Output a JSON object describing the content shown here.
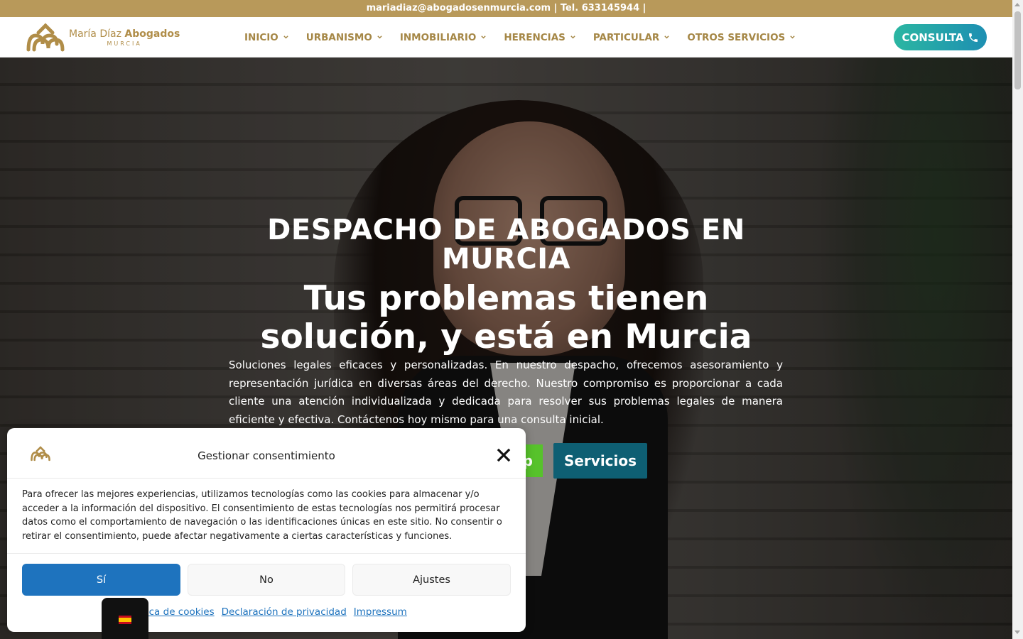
{
  "topbar": {
    "text": "mariadiaz@abogadosenmurcia.com | Tel. 633145944 |"
  },
  "logo": {
    "name_light": "María Díaz ",
    "name_bold": "Abogados",
    "sub": "MURCIA",
    "icon": "logo-icon"
  },
  "nav": {
    "items": [
      {
        "label": "INICIO"
      },
      {
        "label": "URBANISMO"
      },
      {
        "label": "INMOBILIARIO"
      },
      {
        "label": "HERENCIAS"
      },
      {
        "label": "PARTICULAR"
      },
      {
        "label": "OTROS SERVICIOS"
      }
    ],
    "chevron_icon": "chevron-down-icon"
  },
  "cta": {
    "label": "CONSULTA",
    "icon": "phone-icon"
  },
  "hero": {
    "title": "DESPACHO DE ABOGADOS EN MURCIA",
    "subtitle": "Tus problemas tienen solución, y está en Murcia",
    "paragraph": "Soluciones legales eficaces y personalizadas. En nuestro despacho, ofrecemos asesoramiento y representación jurídica en diversas áreas del derecho. Nuestro compromiso es proporcionar a cada cliente una atención individualizada y dedicada para resolver sus problemas legales de manera eficiente y efectiva. Contáctenos hoy mismo para una consulta inicial.",
    "green_button_visible_text": "p",
    "services_button": "Servicios"
  },
  "cookie_modal": {
    "title": "Gestionar consentimiento",
    "body": "Para ofrecer las mejores experiencias, utilizamos tecnologías como las cookies para almacenar y/o acceder a la información del dispositivo. El consentimiento de estas tecnologías nos permitirá procesar datos como el comportamiento de navegación o las identificaciones únicas en este sitio. No consentir o retirar el consentimiento, puede afectar negativamente a ciertas características y funciones.",
    "buttons": {
      "accept": "Sí",
      "deny": "No",
      "settings": "Ajustes"
    },
    "links": {
      "cookie_policy": "Política de cookies",
      "privacy": "Declaración de privacidad",
      "impressum": "Impressum"
    },
    "close_icon": "close-icon"
  },
  "language": {
    "flag_icon": "spain-flag-icon"
  },
  "colors": {
    "topbar": "#b8995a",
    "nav_text": "#a58746",
    "cta_gradient_start": "#2bb6a2",
    "cta_gradient_end": "#1d8fb2",
    "accept_button": "#1e73be",
    "services_button": "#0e5f73",
    "green_button": "#57c22b"
  }
}
